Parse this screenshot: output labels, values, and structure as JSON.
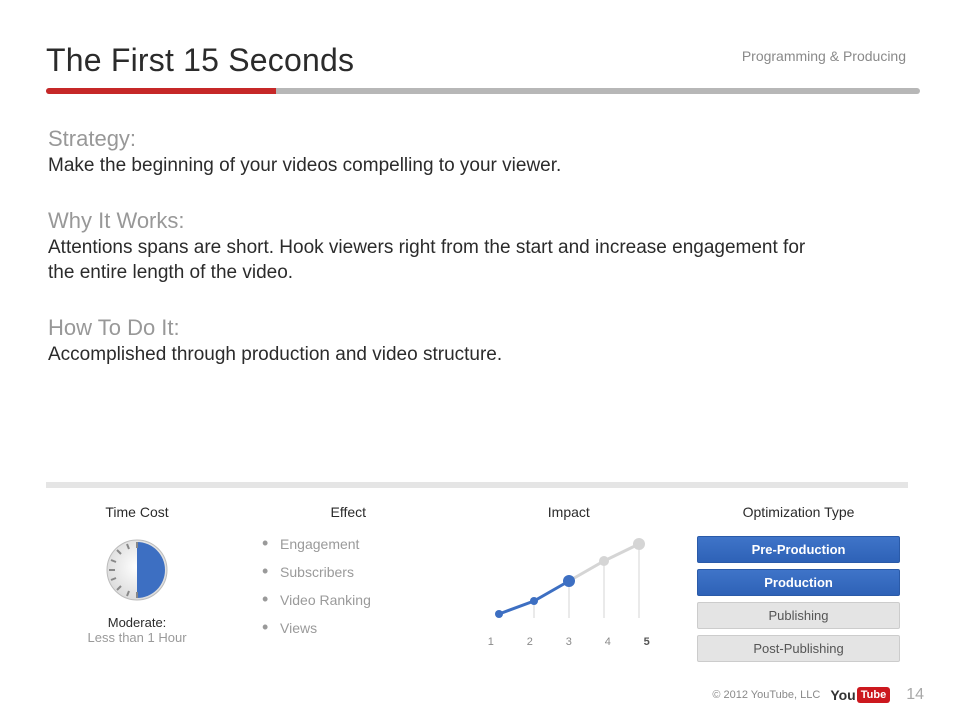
{
  "header": {
    "title": "The First 15 Seconds",
    "category": "Programming & Producing"
  },
  "sections": {
    "strategy": {
      "label": "Strategy:",
      "body": "Make the beginning of your videos compelling to your viewer."
    },
    "why": {
      "label": "Why It Works:",
      "body": "Attentions spans are short. Hook viewers right from the start and increase engagement for the entire length of the video."
    },
    "how": {
      "label": "How To Do It:",
      "body": "Accomplished through production and video structure."
    }
  },
  "metrics": {
    "time_cost": {
      "title": "Time Cost",
      "label": "Moderate:",
      "sub": "Less than 1 Hour"
    },
    "effect": {
      "title": "Effect",
      "items": [
        "Engagement",
        "Subscribers",
        "Video Ranking",
        "Views"
      ]
    },
    "impact": {
      "title": "Impact",
      "scale": [
        "1",
        "2",
        "3",
        "4",
        "5"
      ],
      "value": 3
    },
    "optimization": {
      "title": "Optimization Type",
      "items": [
        {
          "label": "Pre-Production",
          "active": true
        },
        {
          "label": "Production",
          "active": true
        },
        {
          "label": "Publishing",
          "active": false
        },
        {
          "label": "Post-Publishing",
          "active": false
        }
      ]
    }
  },
  "footer": {
    "copyright": "© 2012 YouTube, LLC",
    "logo_you": "You",
    "logo_tube": "Tube",
    "page": "14"
  }
}
